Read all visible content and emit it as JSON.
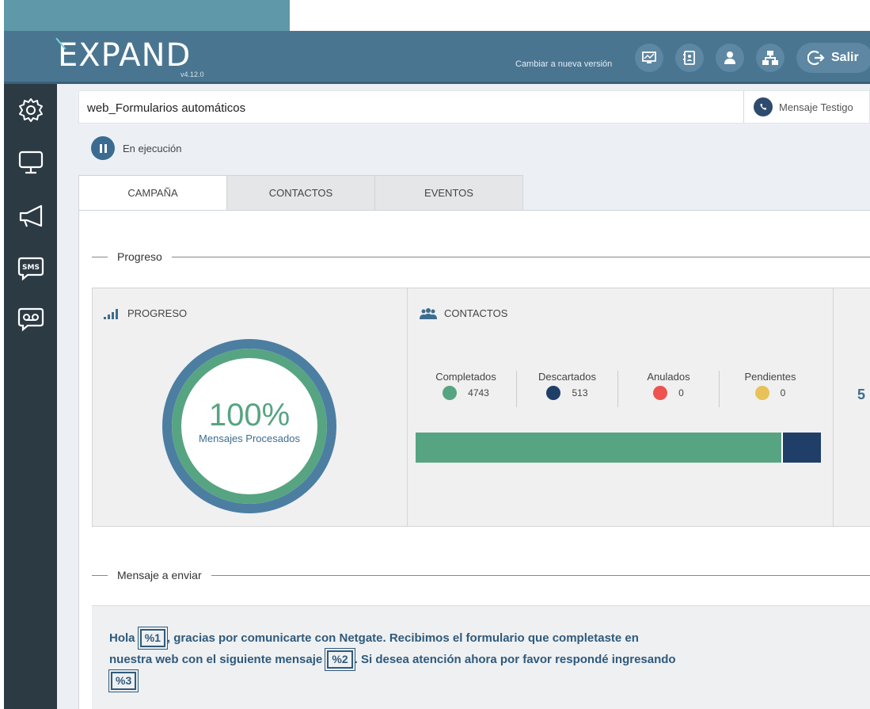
{
  "header": {
    "logo": "EXPAND",
    "version": "v4.12.0",
    "change_version": "Cambiar a nueva versión",
    "icons": [
      "monitor-chart-icon",
      "contacts-book-icon",
      "user-icon",
      "network-icon"
    ],
    "logout_label": "Salir"
  },
  "sidebar": {
    "items": [
      {
        "icon": "gear-icon"
      },
      {
        "icon": "monitor-icon"
      },
      {
        "icon": "megaphone-icon"
      },
      {
        "icon": "sms-icon"
      },
      {
        "icon": "voicemail-icon"
      }
    ]
  },
  "campaign": {
    "title": "web_Formularios automáticos",
    "witness_label": "Mensaje Testigo",
    "status": "En ejecución"
  },
  "tabs": [
    {
      "label": "CAMPAÑA",
      "active": true
    },
    {
      "label": "CONTACTOS",
      "active": false
    },
    {
      "label": "EVENTOS",
      "active": false
    }
  ],
  "progress_section": {
    "label": "Progreso",
    "progress_card": {
      "title": "PROGRESO",
      "percent": 100,
      "percent_text": "100%",
      "subtitle": "Mensajes Procesados"
    },
    "contacts_card": {
      "title": "CONTACTOS",
      "stats": [
        {
          "label": "Completados",
          "value": "4743",
          "color": "#57a482"
        },
        {
          "label": "Descartados",
          "value": "513",
          "color": "#1f3f68"
        },
        {
          "label": "Anulados",
          "value": "0",
          "color": "#ef5350"
        },
        {
          "label": "Pendientes",
          "value": "0",
          "color": "#e8c159"
        }
      ],
      "bar": [
        {
          "value": 4743,
          "color": "#57a482"
        },
        {
          "value": 513,
          "color": "#1f3f68"
        }
      ]
    },
    "partial_value": "5"
  },
  "message_section": {
    "label": "Mensaje a enviar",
    "text_1": "Hola ",
    "var_1": "%1",
    "text_2": ", gracias por comunicarte con Netgate. Recibimos el formulario que completaste en nuestra web con el siguiente mensaje ",
    "var_2": "%2",
    "text_3": ". Si desea atención ahora por favor respondé ingresando ",
    "var_3": "%3"
  },
  "colors": {
    "header": "#4a7591",
    "sidebar": "#2c3a44",
    "accent_green": "#57a482",
    "accent_blue": "#3d6d8e"
  }
}
